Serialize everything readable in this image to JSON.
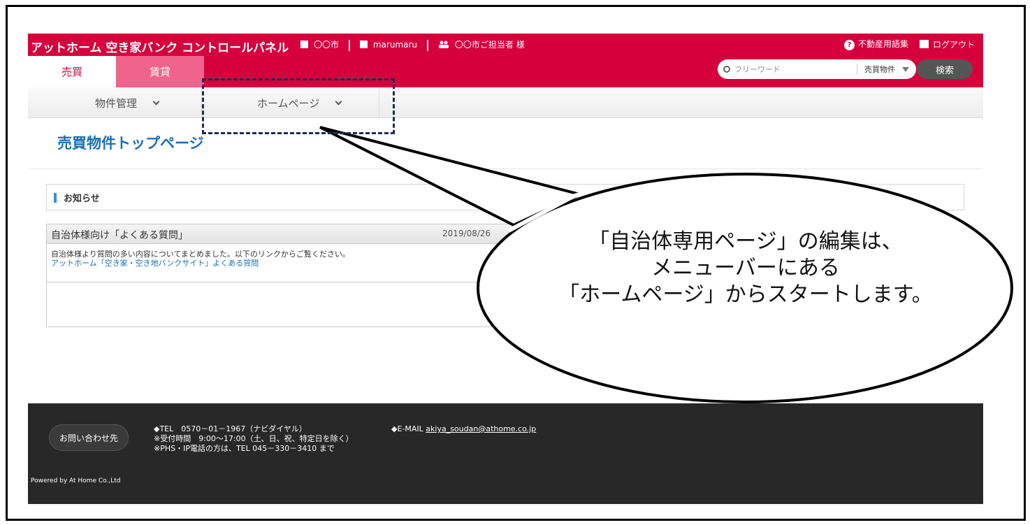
{
  "header": {
    "app_title": "アットホーム 空き家バンク コントロールパネル",
    "city": "〇〇市",
    "account": "marumaru",
    "user": "〇〇市ご担当者 様",
    "glossary": "不動産用語集",
    "logout": "ログアウト",
    "accent_color": "#d6003d"
  },
  "tabs": [
    {
      "label": "売買",
      "active": true
    },
    {
      "label": "賃貸",
      "active": false
    }
  ],
  "search": {
    "placeholder": "フリーワード",
    "category": "売買物件",
    "button": "検索"
  },
  "menu": {
    "items": [
      {
        "label": "物件管理"
      },
      {
        "label": "ホームページ"
      }
    ]
  },
  "page": {
    "title": "売買物件トップページ",
    "notice_label": "お知らせ"
  },
  "faq": {
    "title": "自治体様向け「よくある質問」",
    "date": "2019/08/26",
    "body": "自治体様より質問の多い内容についてまとめました。以下のリンクからご覧ください。",
    "link": "アットホーム「空き家・空き地バンクサイト」よくある質問"
  },
  "footer": {
    "contact_button": "お問い合わせ先",
    "tel_line1": "◆TEL　0570－01－1967（ナビダイヤル）",
    "tel_line2": "※受付時間　9:00～17:00（土、日、祝、特定日を除く）",
    "tel_line3": "※PHS・IP電話の方は、TEL 045－330－3410 まで",
    "email_prefix": "◆E-MAIL",
    "email": "akiya_soudan@athome.co.jp",
    "powered": "Powered by At Home Co.,Ltd"
  },
  "callout": {
    "line1": "「自治体専用ページ」の編集は、",
    "line2": "メニューバーにある",
    "line3": "「ホームページ」からスタートします。"
  }
}
